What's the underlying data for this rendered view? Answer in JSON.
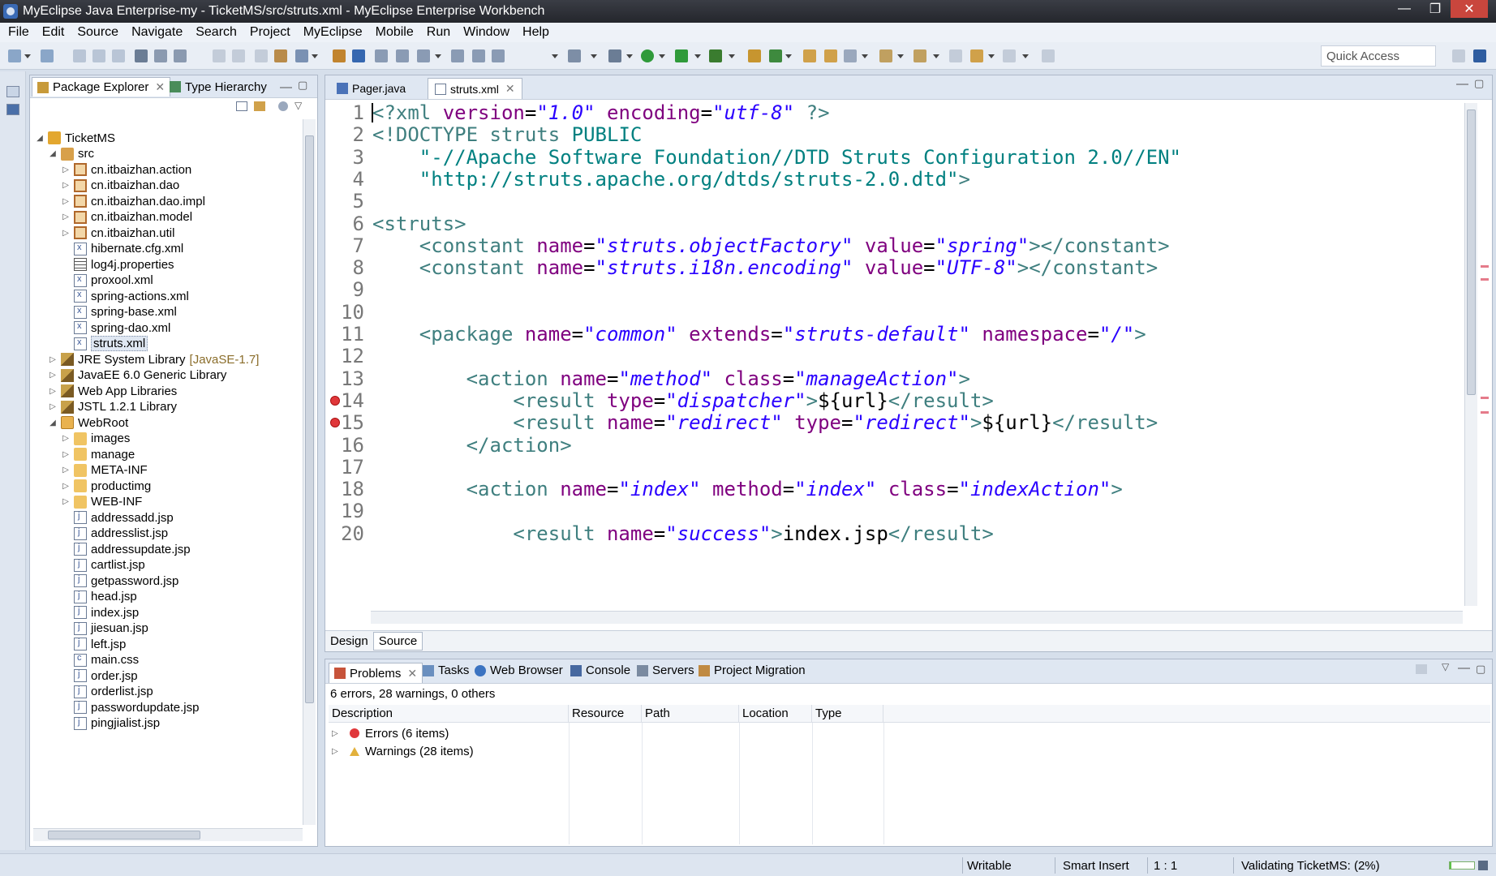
{
  "window": {
    "title": "MyEclipse Java Enterprise-my - TicketMS/src/struts.xml - MyEclipse Enterprise Workbench",
    "controls": [
      "—",
      "❐",
      "✕"
    ]
  },
  "menu": [
    "File",
    "Edit",
    "Source",
    "Navigate",
    "Search",
    "Project",
    "MyEclipse",
    "Mobile",
    "Run",
    "Window",
    "Help"
  ],
  "toolbar": {
    "quick_access_placeholder": "Quick Access"
  },
  "explorer": {
    "tabs": [
      {
        "label": "Package Explorer",
        "active": true
      },
      {
        "label": "Type Hierarchy",
        "active": false
      }
    ],
    "tree": [
      {
        "label": "TicketMS",
        "depth": 0,
        "expand": "open",
        "icon": "project-icon"
      },
      {
        "label": "src",
        "depth": 1,
        "expand": "open",
        "icon": "source-folder-icon"
      },
      {
        "label": "cn.itbaizhan.action",
        "depth": 2,
        "expand": "closed",
        "icon": "package-icon"
      },
      {
        "label": "cn.itbaizhan.dao",
        "depth": 2,
        "expand": "closed",
        "icon": "package-icon"
      },
      {
        "label": "cn.itbaizhan.dao.impl",
        "depth": 2,
        "expand": "closed",
        "icon": "package-icon"
      },
      {
        "label": "cn.itbaizhan.model",
        "depth": 2,
        "expand": "closed",
        "icon": "package-icon"
      },
      {
        "label": "cn.itbaizhan.util",
        "depth": 2,
        "expand": "closed",
        "icon": "package-icon"
      },
      {
        "label": "hibernate.cfg.xml",
        "depth": 2,
        "expand": "none",
        "icon": "xml-file-icon"
      },
      {
        "label": "log4j.properties",
        "depth": 2,
        "expand": "none",
        "icon": "properties-file-icon"
      },
      {
        "label": "proxool.xml",
        "depth": 2,
        "expand": "none",
        "icon": "xml-file-icon"
      },
      {
        "label": "spring-actions.xml",
        "depth": 2,
        "expand": "none",
        "icon": "xml-file-icon"
      },
      {
        "label": "spring-base.xml",
        "depth": 2,
        "expand": "none",
        "icon": "xml-file-icon"
      },
      {
        "label": "spring-dao.xml",
        "depth": 2,
        "expand": "none",
        "icon": "xml-file-icon"
      },
      {
        "label": "struts.xml",
        "depth": 2,
        "expand": "none",
        "icon": "xml-file-icon",
        "selected": true
      },
      {
        "label": "JRE System Library",
        "decor": "[JavaSE-1.7]",
        "depth": 1,
        "expand": "closed",
        "icon": "library-icon"
      },
      {
        "label": "JavaEE 6.0 Generic Library",
        "depth": 1,
        "expand": "closed",
        "icon": "library-icon"
      },
      {
        "label": "Web App Libraries",
        "depth": 1,
        "expand": "closed",
        "icon": "library-icon"
      },
      {
        "label": "JSTL 1.2.1 Library",
        "depth": 1,
        "expand": "closed",
        "icon": "library-icon"
      },
      {
        "label": "WebRoot",
        "depth": 1,
        "expand": "open",
        "icon": "web-folder-icon"
      },
      {
        "label": "images",
        "depth": 2,
        "expand": "closed",
        "icon": "folder-icon"
      },
      {
        "label": "manage",
        "depth": 2,
        "expand": "closed",
        "icon": "folder-icon"
      },
      {
        "label": "META-INF",
        "depth": 2,
        "expand": "closed",
        "icon": "folder-icon"
      },
      {
        "label": "productimg",
        "depth": 2,
        "expand": "closed",
        "icon": "folder-icon"
      },
      {
        "label": "WEB-INF",
        "depth": 2,
        "expand": "closed",
        "icon": "folder-icon"
      },
      {
        "label": "addressadd.jsp",
        "depth": 2,
        "expand": "none",
        "icon": "jsp-file-icon"
      },
      {
        "label": "addresslist.jsp",
        "depth": 2,
        "expand": "none",
        "icon": "jsp-file-icon"
      },
      {
        "label": "addressupdate.jsp",
        "depth": 2,
        "expand": "none",
        "icon": "jsp-file-icon"
      },
      {
        "label": "cartlist.jsp",
        "depth": 2,
        "expand": "none",
        "icon": "jsp-file-icon"
      },
      {
        "label": "getpassword.jsp",
        "depth": 2,
        "expand": "none",
        "icon": "jsp-file-icon"
      },
      {
        "label": "head.jsp",
        "depth": 2,
        "expand": "none",
        "icon": "jsp-file-icon"
      },
      {
        "label": "index.jsp",
        "depth": 2,
        "expand": "none",
        "icon": "jsp-file-icon"
      },
      {
        "label": "jiesuan.jsp",
        "depth": 2,
        "expand": "none",
        "icon": "jsp-file-icon"
      },
      {
        "label": "left.jsp",
        "depth": 2,
        "expand": "none",
        "icon": "jsp-file-icon"
      },
      {
        "label": "main.css",
        "depth": 2,
        "expand": "none",
        "icon": "css-file-icon"
      },
      {
        "label": "order.jsp",
        "depth": 2,
        "expand": "none",
        "icon": "jsp-file-icon"
      },
      {
        "label": "orderlist.jsp",
        "depth": 2,
        "expand": "none",
        "icon": "jsp-file-icon"
      },
      {
        "label": "passwordupdate.jsp",
        "depth": 2,
        "expand": "none",
        "icon": "jsp-file-icon"
      },
      {
        "label": "pingjialist.jsp",
        "depth": 2,
        "expand": "none",
        "icon": "jsp-file-icon"
      }
    ]
  },
  "editor": {
    "tabs": [
      {
        "label": "Pager.java",
        "active": false
      },
      {
        "label": "struts.xml",
        "active": true
      }
    ],
    "lines": [
      {
        "n": "1",
        "err": false,
        "tokens": [
          [
            "t-tag",
            "<?xml "
          ],
          [
            "t-attr",
            "version"
          ],
          [
            "t-txt",
            "="
          ],
          [
            "t-val",
            "\"1.0\""
          ],
          [
            "t-txt",
            " "
          ],
          [
            "t-attr",
            "encoding"
          ],
          [
            "t-txt",
            "="
          ],
          [
            "t-val",
            "\"utf-8\""
          ],
          [
            "t-tag",
            " ?>"
          ]
        ]
      },
      {
        "n": "2",
        "err": false,
        "tokens": [
          [
            "t-tag",
            "<!DOCTYPE struts "
          ],
          [
            "t-dt",
            "PUBLIC"
          ]
        ]
      },
      {
        "n": "3",
        "err": false,
        "tokens": [
          [
            "t-dt",
            "    \"-//Apache Software Foundation//DTD Struts Configuration 2.0//EN\""
          ]
        ]
      },
      {
        "n": "4",
        "err": false,
        "tokens": [
          [
            "t-dt",
            "    \"http://struts.apache.org/dtds/struts-2.0.dtd\""
          ],
          [
            "t-tag",
            ">"
          ]
        ]
      },
      {
        "n": "5",
        "err": false,
        "tokens": []
      },
      {
        "n": "6",
        "err": false,
        "tokens": [
          [
            "t-tag",
            "<struts>"
          ]
        ]
      },
      {
        "n": "7",
        "err": false,
        "tokens": [
          [
            "t-tag",
            "    <constant "
          ],
          [
            "t-attr",
            "name"
          ],
          [
            "t-txt",
            "="
          ],
          [
            "t-val",
            "\"struts.objectFactory\""
          ],
          [
            "t-txt",
            " "
          ],
          [
            "t-attr",
            "value"
          ],
          [
            "t-txt",
            "="
          ],
          [
            "t-val",
            "\"spring\""
          ],
          [
            "t-tag",
            "></constant>"
          ]
        ]
      },
      {
        "n": "8",
        "err": false,
        "tokens": [
          [
            "t-tag",
            "    <constant "
          ],
          [
            "t-attr",
            "name"
          ],
          [
            "t-txt",
            "="
          ],
          [
            "t-val",
            "\"struts.i18n.encoding\""
          ],
          [
            "t-txt",
            " "
          ],
          [
            "t-attr",
            "value"
          ],
          [
            "t-txt",
            "="
          ],
          [
            "t-val",
            "\"UTF-8\""
          ],
          [
            "t-tag",
            "></constant>"
          ]
        ]
      },
      {
        "n": "9",
        "err": false,
        "tokens": []
      },
      {
        "n": "10",
        "err": false,
        "tokens": []
      },
      {
        "n": "11",
        "err": false,
        "tokens": [
          [
            "t-tag",
            "    <package "
          ],
          [
            "t-attr",
            "name"
          ],
          [
            "t-txt",
            "="
          ],
          [
            "t-val",
            "\"common\""
          ],
          [
            "t-txt",
            " "
          ],
          [
            "t-attr",
            "extends"
          ],
          [
            "t-txt",
            "="
          ],
          [
            "t-val",
            "\"struts-default\""
          ],
          [
            "t-txt",
            " "
          ],
          [
            "t-attr",
            "namespace"
          ],
          [
            "t-txt",
            "="
          ],
          [
            "t-val",
            "\"/\""
          ],
          [
            "t-tag",
            ">"
          ]
        ]
      },
      {
        "n": "12",
        "err": false,
        "tokens": []
      },
      {
        "n": "13",
        "err": false,
        "tokens": [
          [
            "t-tag",
            "        <action "
          ],
          [
            "t-attr",
            "name"
          ],
          [
            "t-txt",
            "="
          ],
          [
            "t-val",
            "\"method\""
          ],
          [
            "t-txt",
            " "
          ],
          [
            "t-attr",
            "class"
          ],
          [
            "t-txt",
            "="
          ],
          [
            "t-val",
            "\"manageAction\""
          ],
          [
            "t-tag",
            ">"
          ]
        ]
      },
      {
        "n": "14",
        "err": true,
        "tokens": [
          [
            "t-tag",
            "            <result "
          ],
          [
            "t-attr",
            "type"
          ],
          [
            "t-txt",
            "="
          ],
          [
            "t-val",
            "\"dispatcher\""
          ],
          [
            "t-tag",
            ">"
          ],
          [
            "t-txt",
            "${url}"
          ],
          [
            "t-tag",
            "</result>"
          ]
        ]
      },
      {
        "n": "15",
        "err": true,
        "tokens": [
          [
            "t-tag",
            "            <result "
          ],
          [
            "t-attr",
            "name"
          ],
          [
            "t-txt",
            "="
          ],
          [
            "t-val",
            "\"redirect\""
          ],
          [
            "t-txt",
            " "
          ],
          [
            "t-attr",
            "type"
          ],
          [
            "t-txt",
            "="
          ],
          [
            "t-val",
            "\"redirect\""
          ],
          [
            "t-tag",
            ">"
          ],
          [
            "t-txt",
            "${url}"
          ],
          [
            "t-tag",
            "</result>"
          ]
        ]
      },
      {
        "n": "16",
        "err": false,
        "tokens": [
          [
            "t-tag",
            "        </action>"
          ]
        ]
      },
      {
        "n": "17",
        "err": false,
        "tokens": []
      },
      {
        "n": "18",
        "err": false,
        "tokens": [
          [
            "t-tag",
            "        <action "
          ],
          [
            "t-attr",
            "name"
          ],
          [
            "t-txt",
            "="
          ],
          [
            "t-val",
            "\"index\""
          ],
          [
            "t-txt",
            " "
          ],
          [
            "t-attr",
            "method"
          ],
          [
            "t-txt",
            "="
          ],
          [
            "t-val",
            "\"index\""
          ],
          [
            "t-txt",
            " "
          ],
          [
            "t-attr",
            "class"
          ],
          [
            "t-txt",
            "="
          ],
          [
            "t-val",
            "\"indexAction\""
          ],
          [
            "t-tag",
            ">"
          ]
        ]
      },
      {
        "n": "19",
        "err": false,
        "tokens": []
      },
      {
        "n": "20",
        "err": false,
        "tokens": [
          [
            "t-tag",
            "            <result "
          ],
          [
            "t-attr",
            "name"
          ],
          [
            "t-txt",
            "="
          ],
          [
            "t-val",
            "\"success\""
          ],
          [
            "t-tag",
            ">"
          ],
          [
            "t-txt",
            "index.jsp"
          ],
          [
            "t-tag",
            "</result>"
          ]
        ]
      }
    ],
    "bottom_tabs": [
      {
        "label": "Design",
        "active": false
      },
      {
        "label": "Source",
        "active": true
      }
    ]
  },
  "problems": {
    "tabs": [
      "Problems",
      "Tasks",
      "Web Browser",
      "Console",
      "Servers",
      "Project Migration"
    ],
    "summary": "6 errors, 28 warnings, 0 others",
    "columns": [
      "Description",
      "Resource",
      "Path",
      "Location",
      "Type"
    ],
    "rows": [
      {
        "label": "Errors (6 items)",
        "kind": "error"
      },
      {
        "label": "Warnings (28 items)",
        "kind": "warning"
      }
    ]
  },
  "status": {
    "writable": "Writable",
    "insert_mode": "Smart Insert",
    "position": "1 : 1",
    "task": "Validating TicketMS: (2%)",
    "progress": 0.02
  },
  "colors": {
    "tag": "#3f7f7f",
    "attr": "#7f007f",
    "value": "#2a00ff",
    "error": "#e0373a",
    "warning": "#e2b13c"
  }
}
